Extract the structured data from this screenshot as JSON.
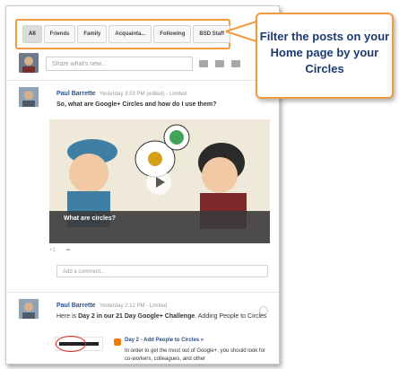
{
  "filter_tabs": [
    "All",
    "Friends",
    "Family",
    "Acquainta...",
    "Following",
    "BSD Staff"
  ],
  "share": {
    "placeholder": "Share what's new..."
  },
  "post1": {
    "author": "Paul Barrette",
    "meta": "Yesterday 3:03 PM (edited) - Limited",
    "text": "So, what are Google+ Circles and how do I use them?",
    "video_title": "What are circles?",
    "plus_count": "+1"
  },
  "comment": {
    "placeholder": "Add a comment..."
  },
  "post2": {
    "author": "Paul Barrette",
    "meta": "Yesterday 2:12 PM - Limited",
    "text_prefix": "Here is ",
    "text_bold": "Day 2 in our 21 Day Google+ Challenge",
    "text_suffix": ". Adding People to Circles",
    "link_title": "Day 2 - Add People to Circles »",
    "link_text": "In order to get the most out of Google+, you should look for co-workers, colleagues, and other"
  },
  "callout": {
    "text": "Filter the posts on your Home page by your Circles"
  },
  "colors": {
    "accent": "#f19a3e",
    "callout_text": "#1b3a72",
    "link": "#2a4f8a"
  }
}
